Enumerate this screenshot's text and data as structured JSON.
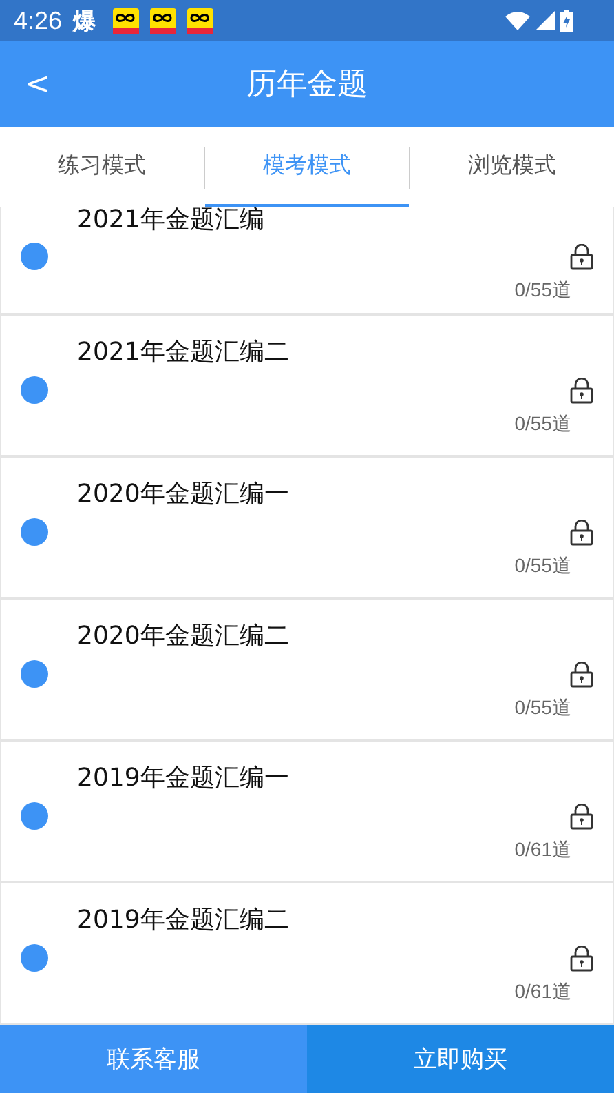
{
  "status_bar": {
    "time": "4:26",
    "notification_glyph": "爆"
  },
  "header": {
    "back": "<",
    "title": "历年金题"
  },
  "tabs": [
    {
      "label": "练习模式",
      "selected": false
    },
    {
      "label": "模考模式",
      "selected": true
    },
    {
      "label": "浏览模式",
      "selected": false
    }
  ],
  "papers": [
    {
      "title": "2021年金题汇编",
      "count": "0/55道",
      "locked": true
    },
    {
      "title": "2021年金题汇编二",
      "count": "0/55道",
      "locked": true
    },
    {
      "title": "2020年金题汇编一",
      "count": "0/55道",
      "locked": true
    },
    {
      "title": "2020年金题汇编二",
      "count": "0/55道",
      "locked": true
    },
    {
      "title": "2019年金题汇编一",
      "count": "0/61道",
      "locked": true
    },
    {
      "title": "2019年金题汇编二",
      "count": "0/61道",
      "locked": true
    }
  ],
  "bottom_buttons": [
    {
      "label": "联系客服",
      "kind": "secondary"
    },
    {
      "label": "立即购买",
      "kind": "primary"
    }
  ]
}
